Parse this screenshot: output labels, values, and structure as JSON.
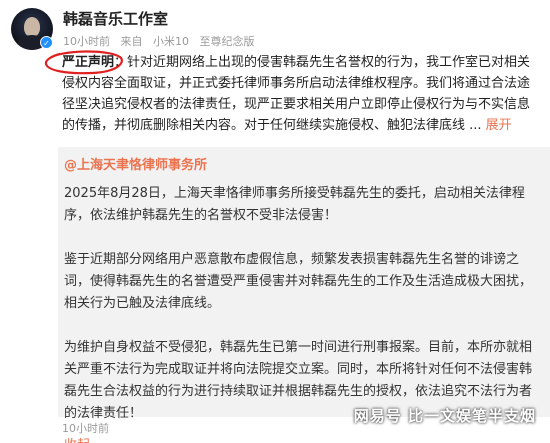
{
  "header": {
    "author_name": "韩磊音乐工作室",
    "meta": {
      "time": "10小时前",
      "source": "来自",
      "device": "小米10",
      "device_suffix": "至尊纪念版"
    }
  },
  "post": {
    "lead": "严正声明",
    "body": "：针对近期网络上出现的侵害韩磊先生名誉权的行为，我工作室已对相关侵权内容全面取证，并正式委托律师事务所启动法律维权程序。我们将通过合法途径坚决追究侵权者的法律责任，现严正要求相关用户立即停止侵权行为与不实信息的传播，并彻底删除相关内容。对于任何继续实施侵权、触犯法律底线 ...",
    "more_label": "展开"
  },
  "quote": {
    "author": "@上海天聿恪律师事务所",
    "paragraphs": [
      "2025年8月28日，上海天聿恪律师事务所接受韩磊先生的委托，启动相关法律程序，依法维护韩磊先生的名誉权不受非法侵害！",
      "鉴于近期部分网络用户恶意散布虚假信息，频繁发表损害韩磊先生名誉的诽谤之词，使得韩磊先生的名誉遭受严重侵害并对韩磊先生的工作及生活造成极大困扰，相关行为已触及法律底线。",
      "为维护自身权益不受侵犯，韩磊先生已第一时间进行刑事报案。目前，本所亦就相关严重不法行为完成取证并将向法院提交立案。同时，本所将针对任何不法侵害韩磊先生合法权益的行为进行持续取证并根据韩磊先生的授权，依法追究不法行为者的法律责任！"
    ],
    "collapse_label": "收起"
  },
  "footer": {
    "time": "10小时前"
  },
  "watermark": "网易号 比一文娱笔半支烟",
  "colors": {
    "accent": "#eb7350",
    "verified": "#1e90ff",
    "quote_bg": "#f2f2f2",
    "circle_mark": "#e02020"
  }
}
